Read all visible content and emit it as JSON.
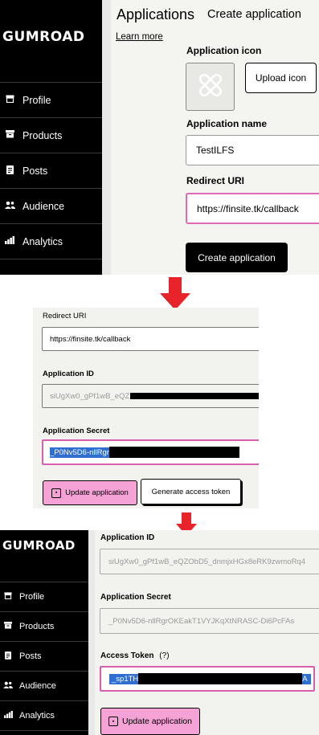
{
  "colors": {
    "arrow": "#e8232a",
    "accent_pink": "#f5a3d7",
    "focus_border": "#e06ab6",
    "selection": "#2e6fd1",
    "sidebar": "#000000"
  },
  "panel1": {
    "logo": "GUMROAD",
    "nav": [
      {
        "label": "Profile",
        "icon": "store-icon"
      },
      {
        "label": "Products",
        "icon": "archive-icon"
      },
      {
        "label": "Posts",
        "icon": "document-icon"
      },
      {
        "label": "Audience",
        "icon": "people-icon"
      },
      {
        "label": "Analytics",
        "icon": "bar-chart-icon"
      }
    ],
    "title": "Applications",
    "subtitle": "Create application",
    "learn_more": "Learn more",
    "app_icon_label": "Application icon",
    "upload_icon_button": "Upload icon",
    "app_name_label": "Application name",
    "app_name_value": "TestILFS",
    "redirect_uri_label": "Redirect URI",
    "redirect_uri_value": "https://finsite.tk/callback",
    "create_button": "Create application"
  },
  "panel2": {
    "redirect_uri_label": "Redirect URI",
    "redirect_uri_value": "https://finsite.tk/callback",
    "app_id_label": "Application ID",
    "app_id_visible": "siUgXw0_gPf1wB_eQZ",
    "app_secret_label": "Application Secret",
    "app_secret_visible": "_P0Nv5D6-nllRgr",
    "update_button": "Update application",
    "generate_button": "Generate access token"
  },
  "panel3": {
    "logo": "GUMROAD",
    "nav": [
      {
        "label": "Profile",
        "icon": "store-icon"
      },
      {
        "label": "Products",
        "icon": "archive-icon"
      },
      {
        "label": "Posts",
        "icon": "document-icon"
      },
      {
        "label": "Audience",
        "icon": "people-icon"
      },
      {
        "label": "Analytics",
        "icon": "bar-chart-icon"
      }
    ],
    "app_id_label": "Application ID",
    "app_id_value": "siUgXw0_gPf1wB_eQZObD5_dnmjxHGx8eRK9zwmoRq4",
    "app_secret_label": "Application Secret",
    "app_secret_value": "_P0Nv5D6-nllRgrOKEakT1VYJKqXtNRASC-Di6PcFAs",
    "access_token_label": "Access Token",
    "access_token_help": "(?)",
    "access_token_start": "_sp1TH",
    "access_token_end": "A",
    "update_button": "Update application"
  }
}
